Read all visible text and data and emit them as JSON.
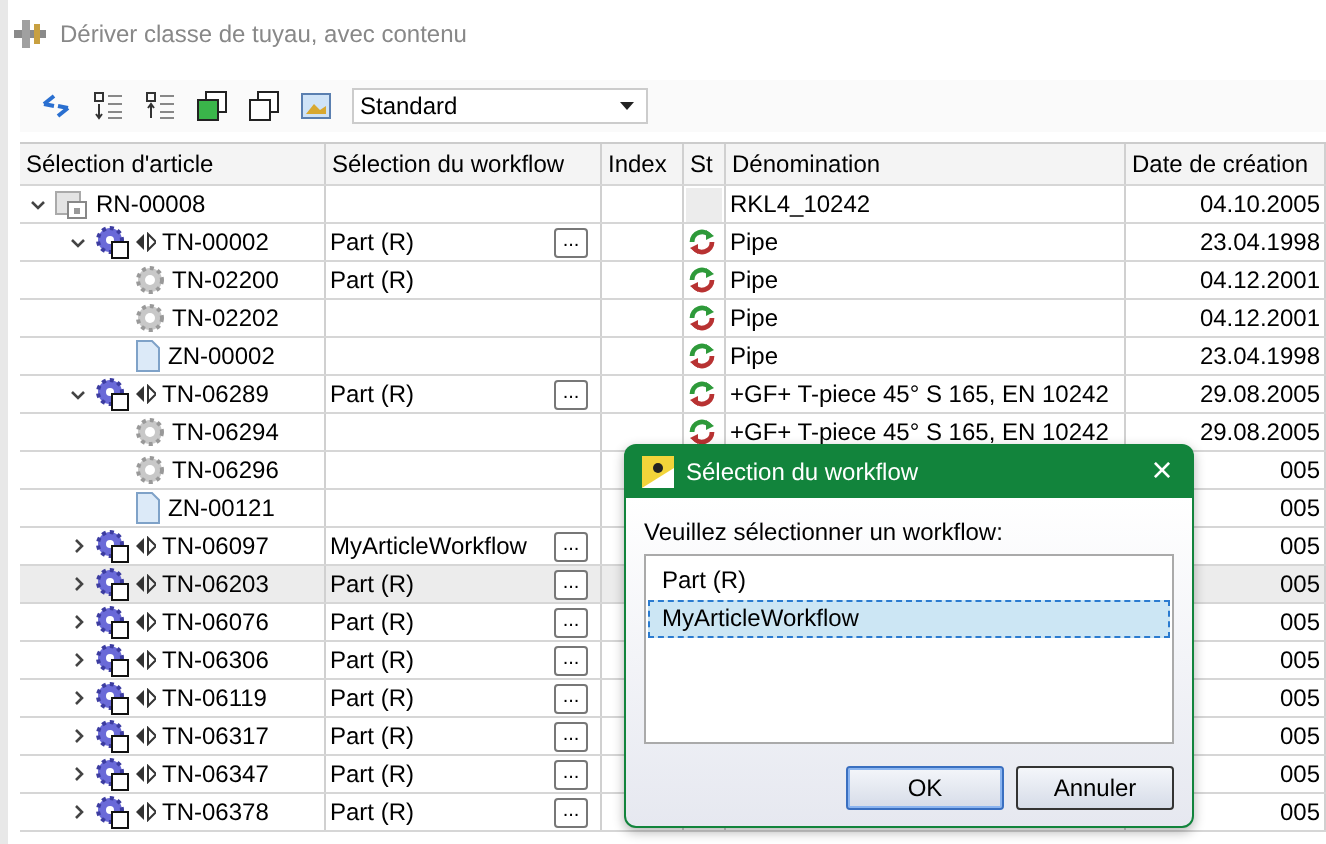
{
  "window": {
    "title": "Dériver classe de tuyau, avec contenu"
  },
  "toolbar": {
    "view": "Standard"
  },
  "table": {
    "columns": [
      "Sélection d'article",
      "Sélection du workflow",
      "Index",
      "St",
      "Dénomination",
      "Date de création"
    ],
    "rows": [
      {
        "id": "RN-00008",
        "kind": "root",
        "expanded": true,
        "selected": false,
        "synced": false,
        "denomination": "RKL4_10242",
        "date": "04.10.2005",
        "children": [
          {
            "id": "TN-00002",
            "kind": "assembly",
            "expanded": true,
            "selected": false,
            "workflow": "Part (R)",
            "browse": "...",
            "synced": true,
            "denomination": "Pipe",
            "date": "23.04.1998",
            "children": [
              {
                "id": "TN-02200",
                "kind": "part",
                "selected": false,
                "workflow": "Part (R)",
                "synced": true,
                "denomination": "Pipe",
                "date": "04.12.2001"
              },
              {
                "id": "TN-02202",
                "kind": "part",
                "selected": false,
                "synced": true,
                "denomination": "Pipe",
                "date": "04.12.2001"
              },
              {
                "id": "ZN-00002",
                "kind": "document",
                "selected": false,
                "synced": true,
                "denomination": "Pipe",
                "date": "23.04.1998"
              }
            ]
          },
          {
            "id": "TN-06289",
            "kind": "assembly",
            "expanded": true,
            "selected": false,
            "workflow": "Part (R)",
            "browse": "...",
            "synced": true,
            "denomination": "+GF+ T-piece 45° S 165, EN 10242",
            "date": "29.08.2005",
            "children": [
              {
                "id": "TN-06294",
                "kind": "part",
                "selected": false,
                "synced": true,
                "denomination": "+GF+ T-piece 45° S 165, EN 10242",
                "date": "29.08.2005"
              },
              {
                "id": "TN-06296",
                "kind": "part",
                "selected": false,
                "date": "005"
              },
              {
                "id": "ZN-00121",
                "kind": "document",
                "selected": false,
                "date": "005"
              }
            ]
          },
          {
            "id": "TN-06097",
            "kind": "assembly",
            "expanded": false,
            "selected": false,
            "workflow": "MyArticleWorkflow",
            "browse": "...",
            "date": "005"
          },
          {
            "id": "TN-06203",
            "kind": "assembly",
            "expanded": false,
            "selected": true,
            "workflow": "Part (R)",
            "browse": "...",
            "date": "005"
          },
          {
            "id": "TN-06076",
            "kind": "assembly",
            "expanded": false,
            "selected": false,
            "workflow": "Part (R)",
            "browse": "...",
            "date": "005"
          },
          {
            "id": "TN-06306",
            "kind": "assembly",
            "expanded": false,
            "selected": false,
            "workflow": "Part (R)",
            "browse": "...",
            "date": "005"
          },
          {
            "id": "TN-06119",
            "kind": "assembly",
            "expanded": false,
            "selected": false,
            "workflow": "Part (R)",
            "browse": "...",
            "date": "005"
          },
          {
            "id": "TN-06317",
            "kind": "assembly",
            "expanded": false,
            "selected": false,
            "workflow": "Part (R)",
            "browse": "...",
            "date": "005"
          },
          {
            "id": "TN-06347",
            "kind": "assembly",
            "expanded": false,
            "selected": false,
            "workflow": "Part (R)",
            "browse": "...",
            "date": "005"
          },
          {
            "id": "TN-06378",
            "kind": "assembly",
            "expanded": false,
            "selected": false,
            "workflow": "Part (R)",
            "browse": "...",
            "date": "005"
          }
        ]
      }
    ]
  },
  "dialog": {
    "title": "Sélection du workflow",
    "close": "×",
    "prompt": "Veuillez sélectionner un workflow:",
    "options": [
      {
        "label": "Part (R)",
        "selected": false
      },
      {
        "label": "MyArticleWorkflow",
        "selected": true
      }
    ],
    "buttons": [
      {
        "label": "OK",
        "default": true
      },
      {
        "label": "Annuler",
        "default": false
      }
    ]
  }
}
